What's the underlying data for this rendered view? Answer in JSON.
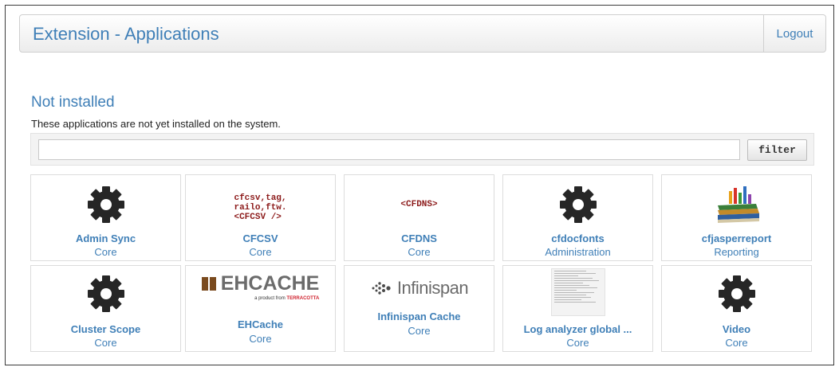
{
  "header": {
    "title": "Extension - Applications",
    "logout_label": "Logout"
  },
  "section": {
    "title": "Not installed",
    "description": "These applications are not yet installed on the system."
  },
  "filter": {
    "value": "",
    "placeholder": "",
    "button_label": "filter"
  },
  "colors": {
    "link_blue": "#3f7fb7",
    "code_red": "#8c1a1a",
    "border": "#dcdcdc"
  },
  "apps": [
    {
      "name": "Admin Sync",
      "category": "Core",
      "icon": "gear-icon"
    },
    {
      "name": "CFCSV",
      "category": "Core",
      "icon": "code-text-icon",
      "icon_text": [
        "cfcsv,tag,",
        "railo,ftw.",
        "<CFCSV />"
      ]
    },
    {
      "name": "CFDNS",
      "category": "Core",
      "icon": "code-text-icon",
      "icon_text": [
        "<CFDNS>"
      ]
    },
    {
      "name": "cfdocfonts",
      "category": "Administration",
      "icon": "gear-icon"
    },
    {
      "name": "cfjasperreport",
      "category": "Reporting",
      "icon": "books-chart-icon"
    },
    {
      "name": "Cluster Scope",
      "category": "Core",
      "icon": "gear-icon"
    },
    {
      "name": "EHCache",
      "category": "Core",
      "icon": "ehcache-logo",
      "logo_text": "EHCACHE",
      "logo_sub": "a product from",
      "logo_sub_brand": "TERRACOTTA"
    },
    {
      "name": "Infinispan Cache",
      "category": "Core",
      "icon": "infinispan-logo",
      "logo_text": "Infinispan"
    },
    {
      "name": "Log analyzer global ...",
      "category": "Core",
      "icon": "log-screenshot-icon"
    },
    {
      "name": "Video",
      "category": "Core",
      "icon": "gear-icon"
    }
  ]
}
